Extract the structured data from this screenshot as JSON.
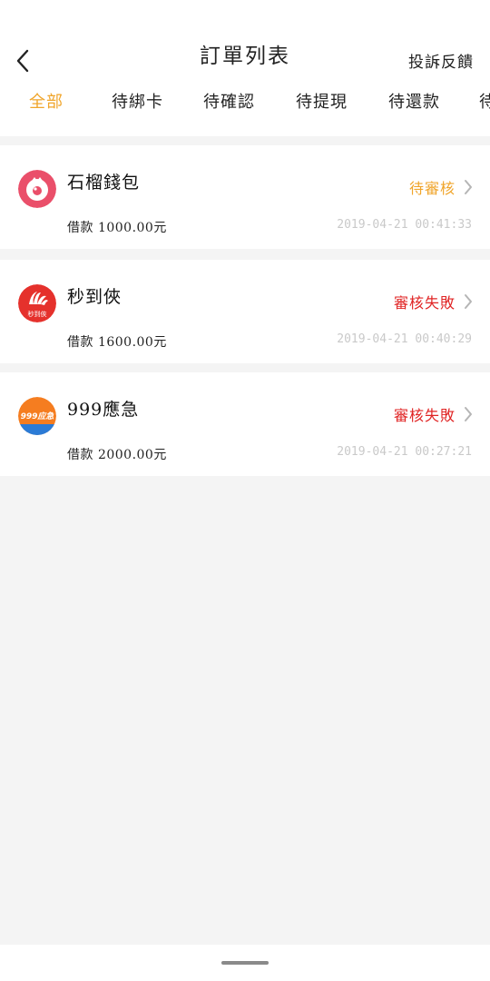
{
  "header": {
    "title": "訂單列表",
    "feedback": "投訴反饋"
  },
  "tabs": [
    "全部",
    "待綁卡",
    "待確認",
    "待提現",
    "待還款",
    "待"
  ],
  "colors": {
    "accent": "#f0a52b",
    "fail": "#e02424",
    "pending": "#f0a52b"
  },
  "orders": [
    {
      "name": "石榴錢包",
      "amount": "借款 1000.00元",
      "status": "待審核",
      "time": "2019-04-21 00:41:33",
      "logo_icon": "pomegranate-icon"
    },
    {
      "name": "秒到俠",
      "amount": "借款 1600.00元",
      "status": "審核失敗",
      "time": "2019-04-21 00:40:29",
      "logo_icon": "miaodaoxia-logo-icon",
      "logo_text": "秒到俠"
    },
    {
      "name": "999應急",
      "amount": "借款 2000.00元",
      "status": "審核失敗",
      "time": "2019-04-21 00:27:21",
      "logo_icon": "999-emergency-logo-icon",
      "logo_text": "999应急"
    }
  ]
}
